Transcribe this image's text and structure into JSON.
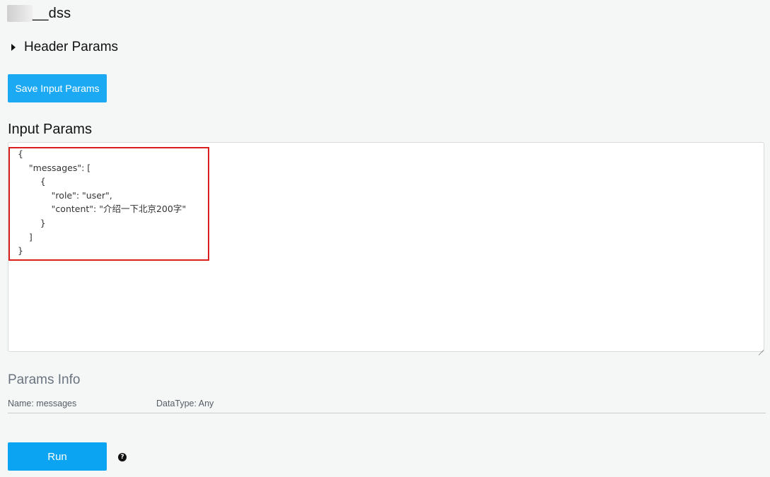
{
  "page": {
    "title_suffix": "__dss"
  },
  "header_params": {
    "label": "Header Params"
  },
  "toolbar": {
    "save_label": "Save Input Params"
  },
  "input_params": {
    "title": "Input Params",
    "value": "{\n    \"messages\": [\n        {\n            \"role\": \"user\",\n            \"content\": \"介绍一下北京200字\"\n        }\n    ]\n}"
  },
  "params_info": {
    "title": "Params Info",
    "rows": [
      {
        "name": "Name: messages",
        "datatype": "DataType: Any"
      }
    ]
  },
  "run": {
    "label": "Run",
    "help_icon": "question-circle-icon"
  },
  "colors": {
    "primary": "#1ba9f4",
    "highlight": "#d9201f",
    "background": "#f5f7f6"
  }
}
